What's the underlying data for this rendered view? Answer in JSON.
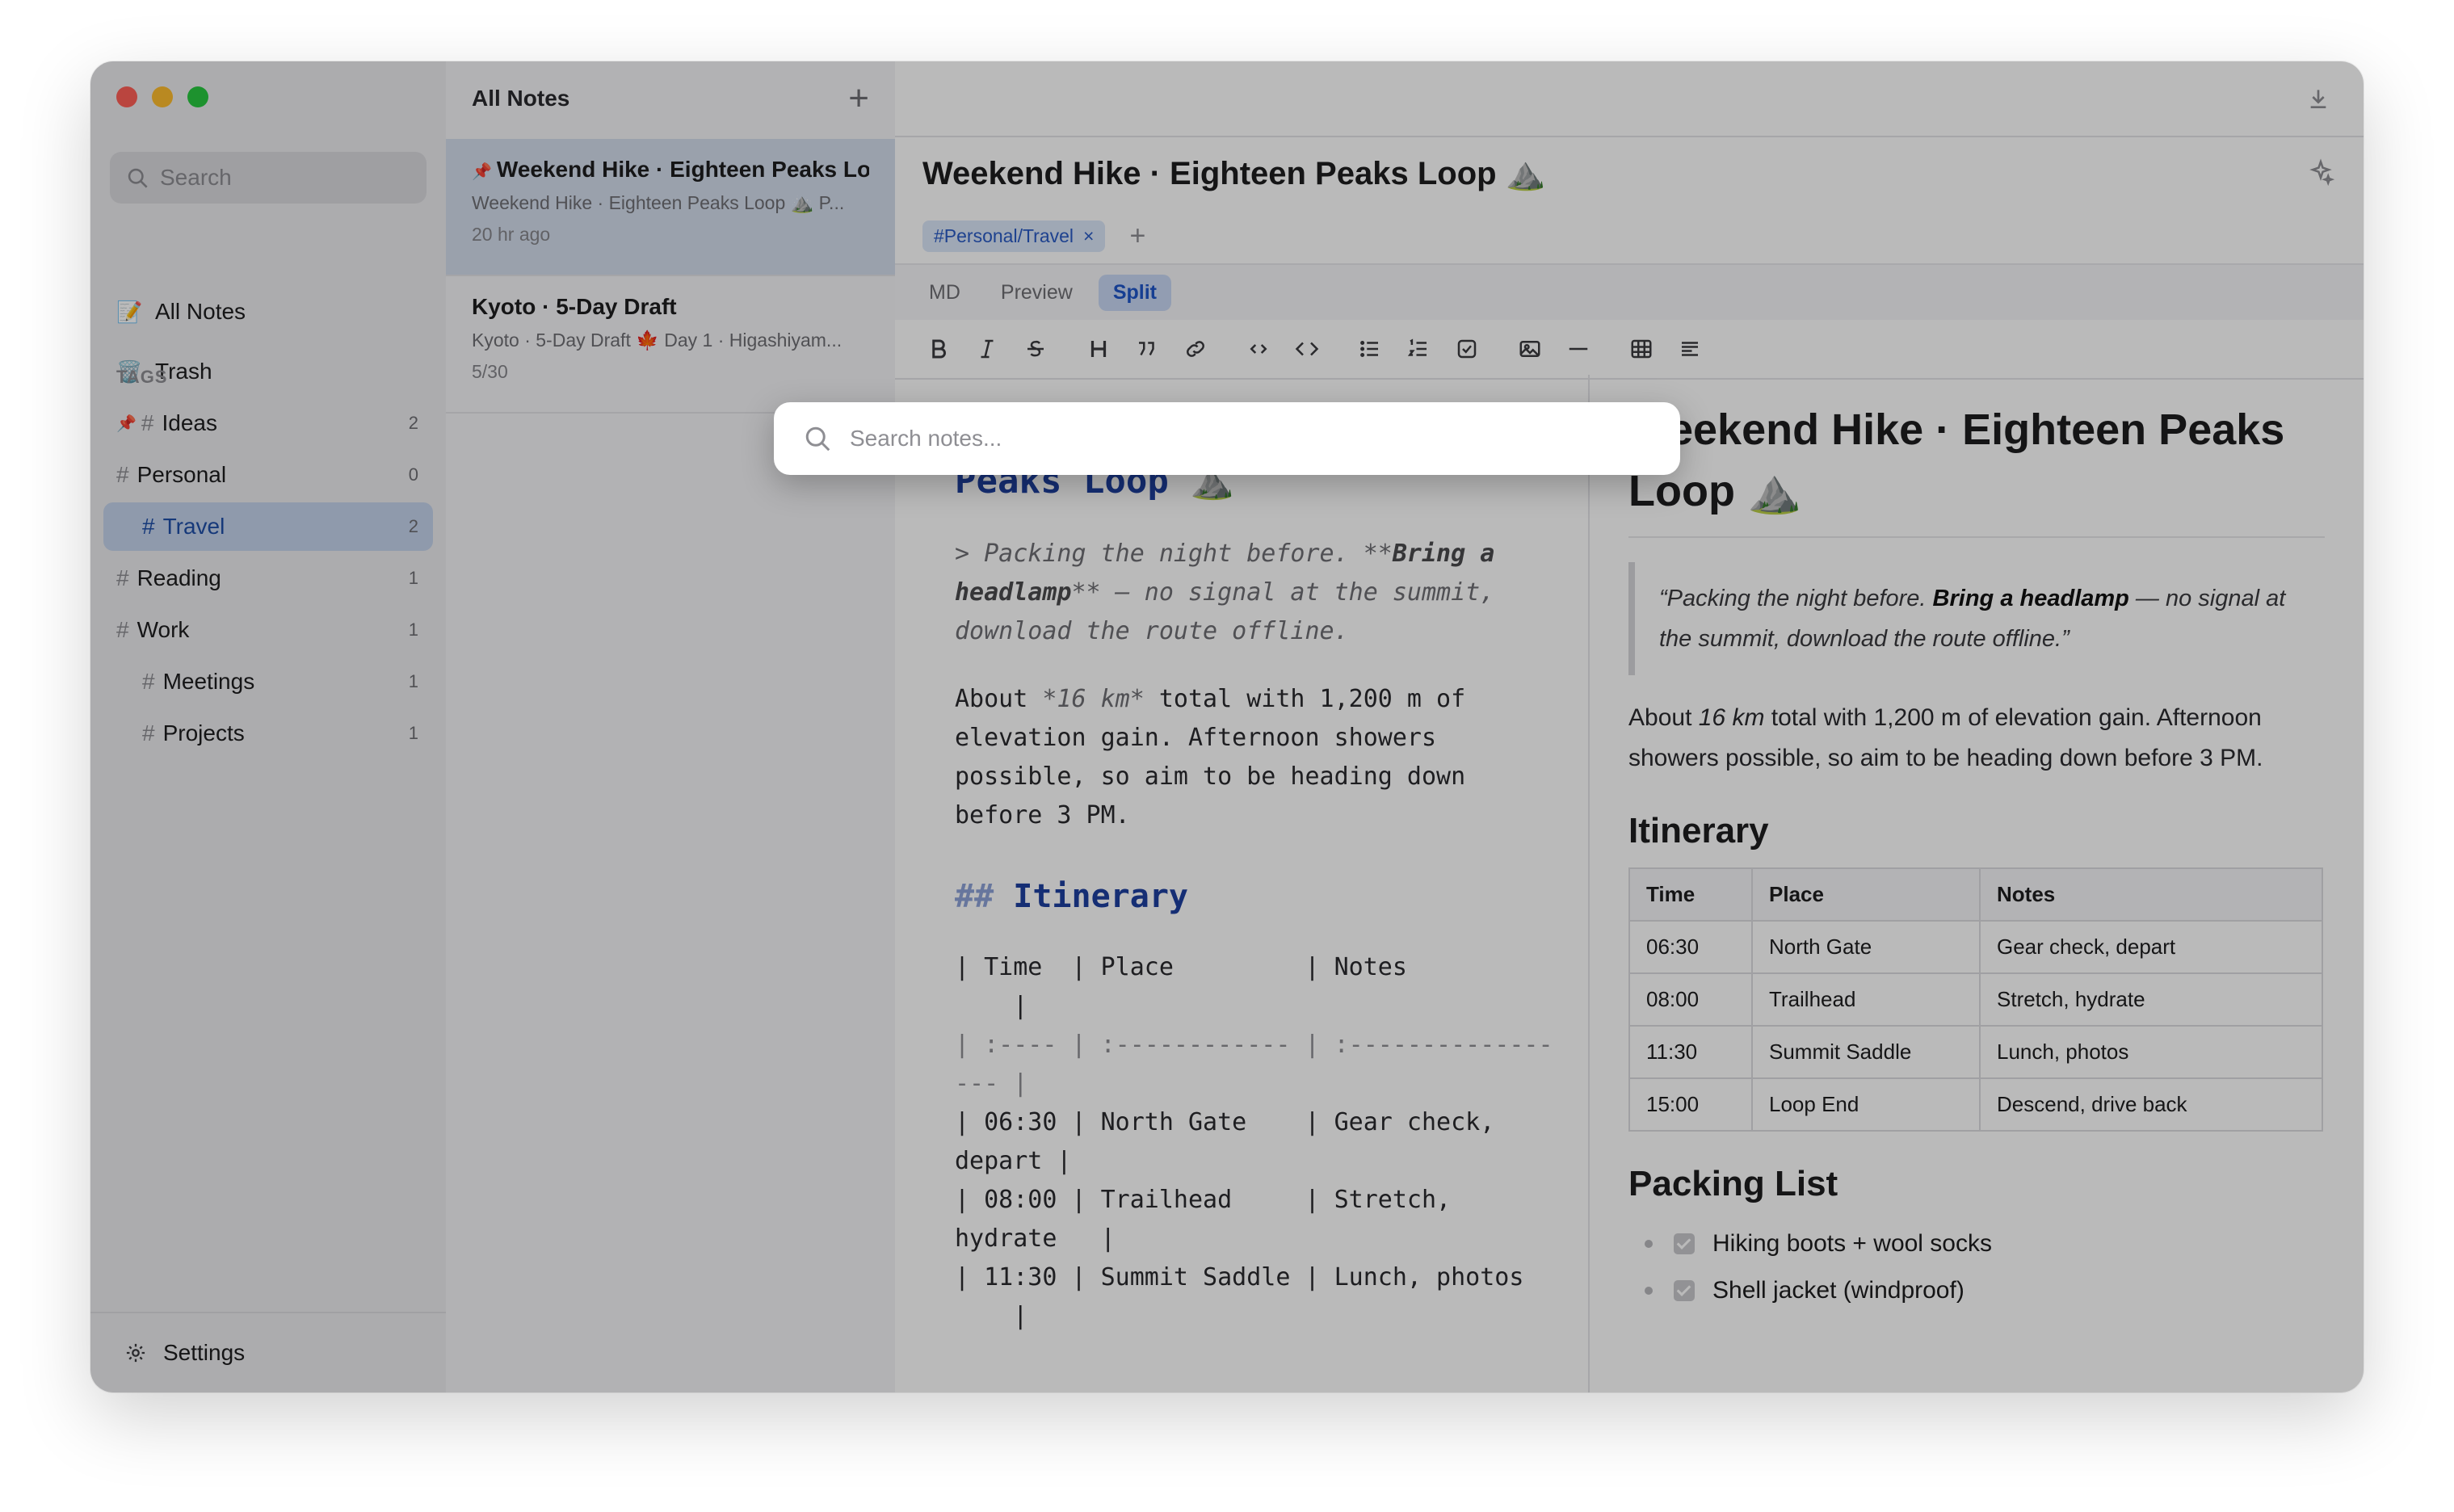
{
  "sidebar": {
    "search_placeholder": "Search",
    "nav": [
      {
        "emoji": "📝",
        "label": "All Notes"
      },
      {
        "emoji": "🗑️",
        "label": "Trash"
      }
    ],
    "tags_header": "TAGS",
    "tags": [
      {
        "label": "Ideas",
        "count": "2",
        "pinned": true
      },
      {
        "label": "Personal",
        "count": "0"
      },
      {
        "label": "Travel",
        "count": "2",
        "active": true
      },
      {
        "label": "Reading",
        "count": "1"
      },
      {
        "label": "Work",
        "count": "1"
      },
      {
        "label": "Meetings",
        "count": "1"
      },
      {
        "label": "Projects",
        "count": "1"
      }
    ],
    "settings_label": "Settings"
  },
  "notelist": {
    "header": "All Notes",
    "notes": [
      {
        "title": "Weekend Hike · Eighteen Peaks Loop",
        "snippet": "Weekend Hike · Eighteen Peaks Loop ⛰️ P...",
        "date": "20 hr ago"
      },
      {
        "title": "Kyoto · 5-Day Draft",
        "snippet": "Kyoto · 5-Day Draft 🍁 Day 1 · Higashiyam...",
        "date": "5/30"
      }
    ]
  },
  "editor": {
    "title": "Weekend Hike · Eighteen Peaks Loop ⛰️",
    "tag_chip": "#Personal/Travel",
    "modes": [
      "MD",
      "Preview",
      "Split"
    ],
    "active_mode": "Split",
    "source": {
      "h1_tail": "Peaks Loop ⛰️",
      "quote_1": "> Packing the night before. **",
      "quote_bold": "Bring a headlamp",
      "quote_2": "** — no signal at the summit, download the route offline.",
      "para_1": "About ",
      "para_km": "*16 km*",
      "para_2": " total with 1,200 m of elevation gain. Afternoon showers possible, so aim to be heading down before 3 PM.",
      "h2_hash": "##",
      "h2_text": "Itinerary",
      "table_lines": [
        "| Time  | Place         | Notes",
        "    |",
        "| :---- | :------------ | :--------------",
        "--- |",
        "| 06:30 | North Gate    | Gear check,",
        "depart |",
        "| 08:00 | Trailhead     | Stretch,",
        "hydrate   |",
        "| 11:30 | Summit Saddle | Lunch, photos",
        "    |"
      ]
    },
    "preview": {
      "h1": "Weekend Hike · Eighteen Peaks Loop ⛰️",
      "quote_1": "“Packing the night before. ",
      "quote_bold": "Bring a headlamp",
      "quote_2": " — no signal at the summit, download the route offline.”",
      "para_1": "About ",
      "para_km": "16 km",
      "para_2": " total with 1,200 m of elevation gain. Afternoon showers possible, so aim to be heading down before 3 PM.",
      "h2_itinerary": "Itinerary",
      "table_headers": [
        "Time",
        "Place",
        "Notes"
      ],
      "table_rows": [
        [
          "06:30",
          "North Gate",
          "Gear check, depart"
        ],
        [
          "08:00",
          "Trailhead",
          "Stretch, hydrate"
        ],
        [
          "11:30",
          "Summit Saddle",
          "Lunch, photos"
        ],
        [
          "15:00",
          "Loop End",
          "Descend, drive back"
        ]
      ],
      "h2_packing": "Packing List",
      "packing": [
        "Hiking boots + wool socks",
        "Shell jacket (windproof)"
      ]
    }
  },
  "palette": {
    "placeholder": "Search notes..."
  },
  "colors": {
    "accent": "#1f55c8",
    "close": "#ff5f57",
    "minimize": "#febc2e",
    "zoom": "#28c840"
  }
}
